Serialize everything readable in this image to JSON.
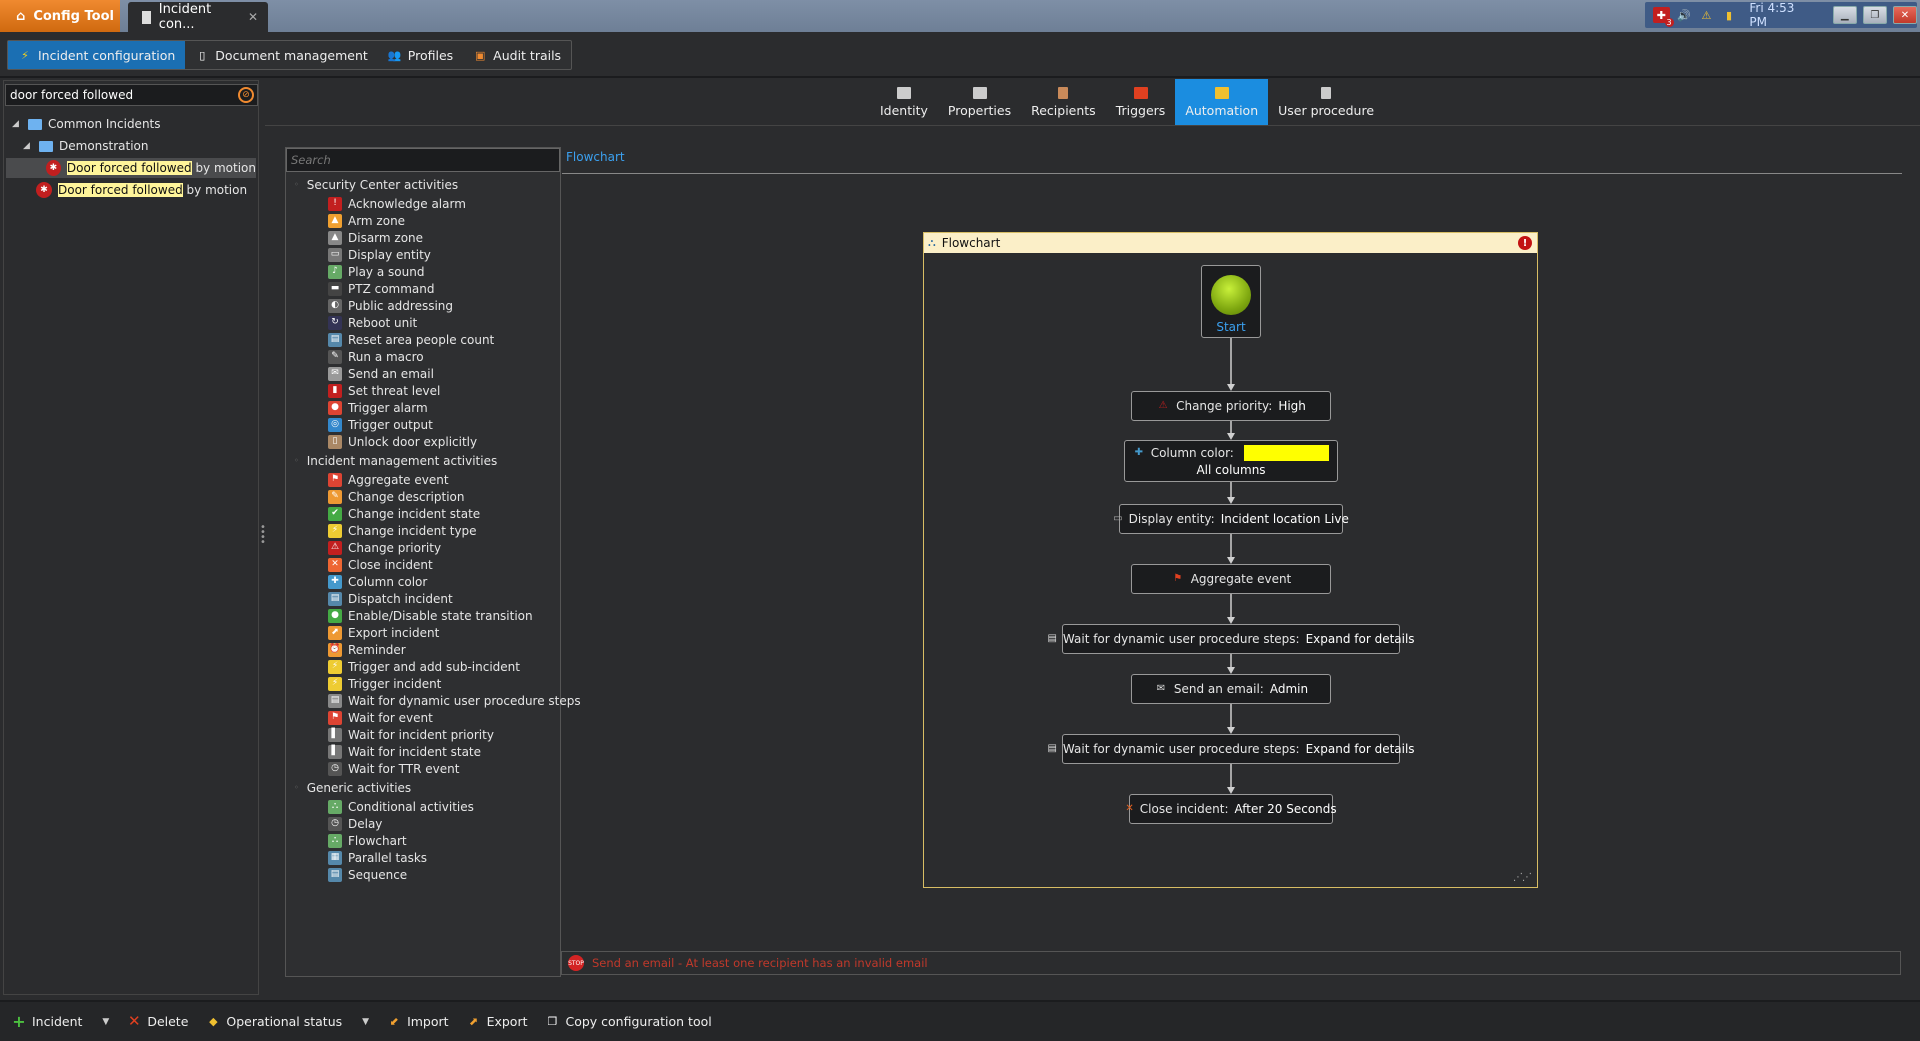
{
  "titlebar": {
    "app_tab": "Config Tool",
    "doc_tab": "Incident con...",
    "clock": "Fri 4:53 PM",
    "badge_count": "3"
  },
  "toolbar": {
    "items": [
      {
        "label": "Incident configuration",
        "active": true
      },
      {
        "label": "Document management"
      },
      {
        "label": "Profiles"
      },
      {
        "label": "Audit trails"
      }
    ]
  },
  "tree": {
    "search_value": "door forced followed",
    "root": "Common Incidents",
    "folder": "Demonstration",
    "items": [
      {
        "match": "Door forced followed",
        "rest": " by motion",
        "selected": true
      },
      {
        "match": "Door forced followed",
        "rest": " by motion"
      }
    ]
  },
  "tabs": [
    {
      "label": "Identity"
    },
    {
      "label": "Properties"
    },
    {
      "label": "Recipients"
    },
    {
      "label": "Triggers"
    },
    {
      "label": "Automation",
      "active": true
    },
    {
      "label": "User procedure"
    }
  ],
  "activities": {
    "search_placeholder": "Search",
    "categories": [
      {
        "name": "Security Center activities",
        "items": [
          "Acknowledge alarm",
          "Arm zone",
          "Disarm zone",
          "Display entity",
          "Play a sound",
          "PTZ command",
          "Public addressing",
          "Reboot unit",
          "Reset area people count",
          "Run a macro",
          "Send an email",
          "Set threat level",
          "Trigger alarm",
          "Trigger output",
          "Unlock door explicitly"
        ]
      },
      {
        "name": "Incident management activities",
        "items": [
          "Aggregate event",
          "Change description",
          "Change incident state",
          "Change incident type",
          "Change priority",
          "Close incident",
          "Column color",
          "Dispatch incident",
          "Enable/Disable state transition",
          "Export incident",
          "Reminder",
          "Trigger and add sub-incident",
          "Trigger incident",
          "Wait for dynamic user procedure steps",
          "Wait for event",
          "Wait for incident priority",
          "Wait for incident state",
          "Wait for TTR event"
        ]
      },
      {
        "name": "Generic activities",
        "items": [
          "Conditional activities",
          "Delay",
          "Flowchart",
          "Parallel tasks",
          "Sequence"
        ]
      }
    ]
  },
  "flowchart": {
    "tab_label": "Flowchart",
    "title": "Flowchart",
    "start_label": "Start",
    "nodes": [
      {
        "label": "Change priority:",
        "value": "High"
      },
      {
        "label": "Column color:",
        "value": "All columns",
        "color": "#ffff00"
      },
      {
        "label": "Display entity:",
        "value": "Incident location Live"
      },
      {
        "label": "Aggregate event",
        "value": ""
      },
      {
        "label": "Wait for dynamic user procedure steps:",
        "value": "Expand for details"
      },
      {
        "label": "Send an email:",
        "value": "Admin"
      },
      {
        "label": "Wait for dynamic user procedure steps:",
        "value": "Expand for details"
      },
      {
        "label": "Close incident:",
        "value": "After 20 Seconds"
      }
    ]
  },
  "error_bar": {
    "message": "Send an email - At least one recipient has an invalid email"
  },
  "bottombar": {
    "items": [
      {
        "label": "Incident"
      },
      {
        "label": "Delete"
      },
      {
        "label": "Operational status"
      },
      {
        "label": "Import"
      },
      {
        "label": "Export"
      },
      {
        "label": "Copy configuration tool"
      }
    ]
  },
  "colors": {
    "accent": "#1b8de0",
    "orange": "#f08a30",
    "error": "#c0392b",
    "highlight": "#fff59a"
  }
}
